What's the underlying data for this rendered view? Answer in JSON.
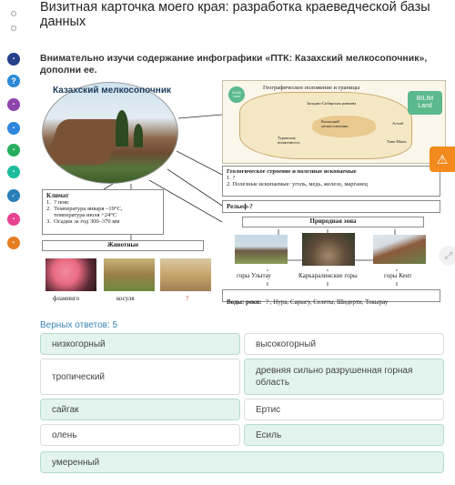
{
  "header": {
    "title": "Визитная карточка моего края: разработка краеведческой базы данных",
    "task": "Внимательно изучи содержание инфографики «ПТК: Казахский мелкосопочник», дополни ее."
  },
  "infographic": {
    "title": "Казахский мелкосопочник",
    "map_title": "Географическое положение и границы",
    "map_labels": {
      "west_siberian": "Западно-Сибирская равнина",
      "kazakh_hills": "Казахский мелкосопочник",
      "turan": "Туранская низменность",
      "altai": "Алтай",
      "tien_shan": "Тянь-Шань"
    },
    "logo_line1": "BILIM",
    "logo_line2": "Land",
    "climate": {
      "heading": "Климат",
      "lines": [
        "1.  ? пояс",
        "2.  Температура января –19°С,",
        "     температура июля +24°С",
        "3.  Осадки за год 300–370 мм"
      ]
    },
    "animals_heading": "Животные",
    "animals": [
      "фламинго",
      "косуля",
      "?"
    ],
    "geology": {
      "heading": "Геологическое строение и полезные ископаемые",
      "lines": [
        "1. ?",
        "2. Полезные ископаемые: уголь, медь, железо, марганец"
      ]
    },
    "relief": "Рельеф-?",
    "natural_zone": "Природная зона",
    "mountains": [
      "горы Улытау",
      "Каркаралинские горы",
      "горы Кент"
    ],
    "waters_label": "Воды: реки:",
    "waters_list": "? , Нура, Сарысу, Селеты, Шидерти, Токырау"
  },
  "answers": {
    "score_text": "Верных ответов: 5",
    "options": [
      {
        "label": "низкогорный",
        "correct": true
      },
      {
        "label": "высокогорный",
        "correct": false
      },
      {
        "label": "тропический",
        "correct": false
      },
      {
        "label": "древняя сильно разрушенная горная область",
        "correct": true
      },
      {
        "label": "сайгак",
        "correct": true
      },
      {
        "label": "Ертис",
        "correct": false
      },
      {
        "label": "олень",
        "correct": false
      },
      {
        "label": "Есиль",
        "correct": true
      },
      {
        "label": "умеренный",
        "correct": true
      }
    ]
  },
  "colors": {
    "correct_bg": "#e3f3ee",
    "accent_blue": "#3a84b8",
    "warning_orange": "#f28a1e"
  },
  "icons": [
    "warning-icon",
    "share-icon"
  ]
}
